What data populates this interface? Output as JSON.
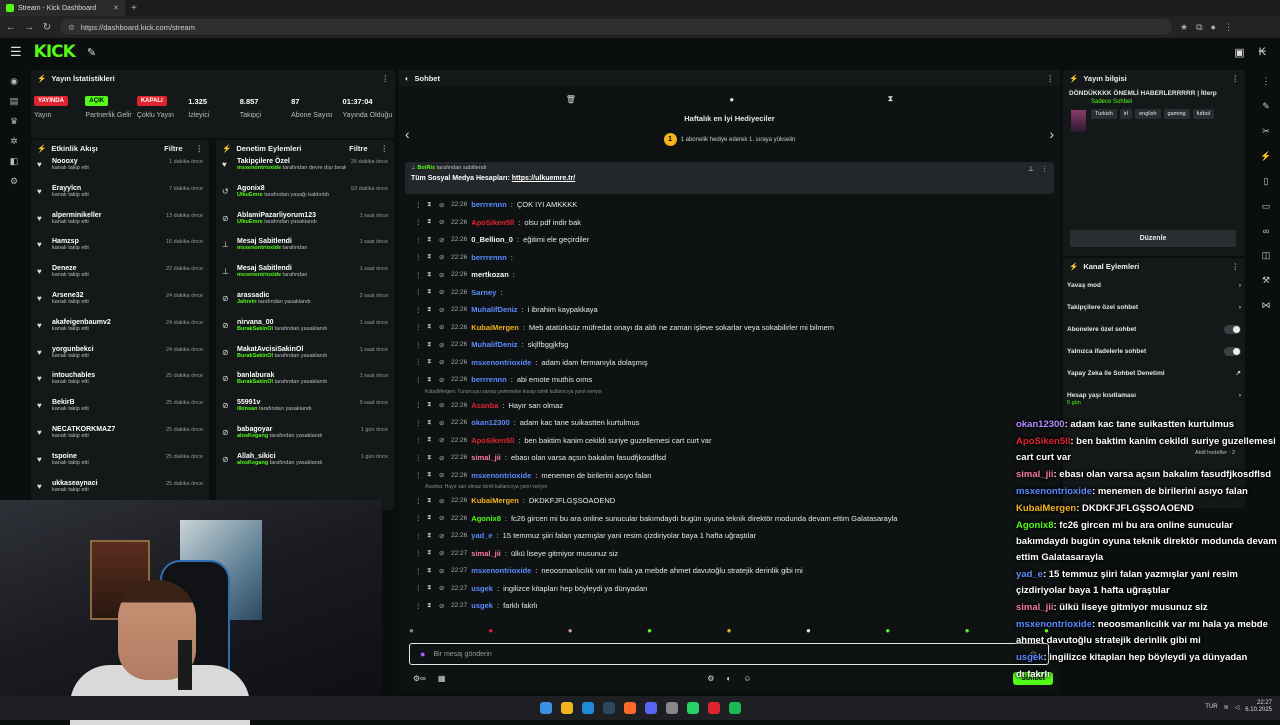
{
  "browser": {
    "tab_title": "Stream - Kick Dashboard",
    "url": "https://dashboard.kick.com/stream"
  },
  "stream_stats": {
    "header": "Yayın İstatistikleri",
    "items": [
      {
        "value": "YAYINDA",
        "label": "Yayın",
        "kind": "badge-red"
      },
      {
        "value": "AÇIK",
        "label": "Partnerlik Gelir",
        "kind": "badge-green"
      },
      {
        "value": "KAPALI",
        "label": "Çoklu Yayın",
        "kind": "badge-red"
      },
      {
        "value": "1.325",
        "label": "İzleyici",
        "kind": "number"
      },
      {
        "value": "8.857",
        "label": "Takipçi",
        "kind": "number"
      },
      {
        "value": "87",
        "label": "Abone Sayısı",
        "kind": "number"
      },
      {
        "value": "01:37:04",
        "label": "Yayında Olduğu",
        "kind": "number"
      }
    ]
  },
  "activity_feed": {
    "header": "Etkinlik Akışı",
    "filter": "Filtre",
    "items": [
      {
        "name": "Noooxy",
        "sub": "kanalı takip etti",
        "time": "1 dakika önce"
      },
      {
        "name": "Erayylcn",
        "sub": "kanalı takip etti",
        "time": "7 dakika önce"
      },
      {
        "name": "alperminikeller",
        "sub": "kanalı takip etti",
        "time": "13 dakika önce"
      },
      {
        "name": "Hamzsp",
        "sub": "kanalı takip etti",
        "time": "16 dakika önce"
      },
      {
        "name": "Deneze",
        "sub": "kanalı takip etti",
        "time": "22 dakika önce"
      },
      {
        "name": "Arsene32",
        "sub": "kanalı takip etti",
        "time": "24 dakika önce"
      },
      {
        "name": "akafeigenbaumv2",
        "sub": "kanalı takip etti",
        "time": "24 dakika önce"
      },
      {
        "name": "yorgunbekci",
        "sub": "kanalı takip etti",
        "time": "24 dakika önce"
      },
      {
        "name": "intouchables",
        "sub": "kanalı takip etti",
        "time": "25 dakika önce"
      },
      {
        "name": "BekirB",
        "sub": "kanalı takip etti",
        "time": "25 dakika önce"
      },
      {
        "name": "NECATKORKMAZ7",
        "sub": "kanalı takip etti",
        "time": "25 dakika önce"
      },
      {
        "name": "tspoine",
        "sub": "kanalı takip etti",
        "time": "25 dakika önce"
      },
      {
        "name": "ukkaseaynaci",
        "sub": "kanalı takip etti",
        "time": "25 dakika önce"
      }
    ]
  },
  "moderation": {
    "header": "Denetim Eylemleri",
    "filter": "Filtre",
    "items": [
      {
        "name": "Takipçilere Özel",
        "actor": "msxenontrioxide",
        "sub": "tarafından devre dışı bırakıldı",
        "time": "26 dakika önce",
        "icon": "♥"
      },
      {
        "name": "Agonix8",
        "actor": "UlkuEmre",
        "sub": "tarafından yasağı kaldırıldı",
        "time": "53 dakika önce",
        "icon": "↺"
      },
      {
        "name": "AblamiPazarliyorum123",
        "actor": "UlkuEmre",
        "sub": "tarafından yasaklandı",
        "time": "1 saat önce",
        "icon": "⊘"
      },
      {
        "name": "Mesaj Sabitlendi",
        "actor": "msxenontrioxide",
        "sub": "tarafından",
        "time": "1 saat önce",
        "icon": "⊥"
      },
      {
        "name": "Mesaj Sabitlendi",
        "actor": "msxenontrioxide",
        "sub": "tarafından",
        "time": "1 saat önce",
        "icon": "⊥"
      },
      {
        "name": "arassadic",
        "actor": "Jahrein",
        "sub": "tarafından yasaklandı",
        "time": "2 saat önce",
        "icon": "⊘"
      },
      {
        "name": "nirvana_00",
        "actor": "BurakSakinOl",
        "sub": "tarafından yasaklandı",
        "time": "1 saat önce",
        "icon": "⊘"
      },
      {
        "name": "MakatAvcisiSakinOl",
        "actor": "BurakSakinOl",
        "sub": "tarafından yasaklandı",
        "time": "1 saat önce",
        "icon": "⊘"
      },
      {
        "name": "banlaburak",
        "actor": "BurakSakinOl",
        "sub": "tarafından yasaklandı",
        "time": "1 saat önce",
        "icon": "⊘"
      },
      {
        "name": "55991v",
        "actor": "ilkinsan",
        "sub": "tarafından yasaklandı",
        "time": "9 saat önce",
        "icon": "⊘"
      },
      {
        "name": "babagoyar",
        "actor": "alosKegang",
        "sub": "tarafından yasaklandı",
        "time": "1 gün önce",
        "icon": "⊘"
      },
      {
        "name": "Allah_sikici",
        "actor": "alosKegang",
        "sub": "tarafından yasaklandı",
        "time": "1 gün önce",
        "icon": "⊘"
      }
    ]
  },
  "chat": {
    "header": "Sohbet",
    "gifters_title": "Haftalık en İyi Hediyeciler",
    "gifters_sub": "1 abonelik hediye ederek 1. sıraya yükselin",
    "gifters_rank": "1",
    "pinned_by": "BotRix",
    "pinned_suffix": "tarafından sabitlendi",
    "pinned_text": "Tüm Sosyal Medya Hesapları:",
    "pinned_link": "https://ulkuemre.tr/",
    "messages": [
      {
        "time": "22:26",
        "user": "berrrennn",
        "color": "#5a8cff",
        "text": "ÇOK IYI AMKKKK"
      },
      {
        "time": "22:26",
        "user": "ApoSiken5ll",
        "color": "#e0242f",
        "text": "olsu pdf indir bak"
      },
      {
        "time": "22:26",
        "user": "0_Bellion_0",
        "color": "#f3f3f3",
        "text": "eğitimi ele geçirdiler"
      },
      {
        "time": "22:26",
        "user": "berrrennn",
        "color": "#5a8cff",
        "text": ""
      },
      {
        "time": "22:26",
        "user": "mertkozan",
        "color": "#f3f3f3",
        "text": ""
      },
      {
        "time": "22:26",
        "user": "Sarney",
        "color": "#5a8cff",
        "text": ""
      },
      {
        "time": "22:26",
        "user": "MuhalifDeniz",
        "color": "#5a8cff",
        "text": "i ibrahim kaypakkaya"
      },
      {
        "time": "22:26",
        "user": "KubaiMergen",
        "color": "#f3b31c",
        "text": "Meb atatürksüz müfredat onayı da aldı ne zaman işleve sokarlar veya sokabilirler mi bilmem"
      },
      {
        "time": "22:26",
        "user": "MuhalifDeniz",
        "color": "#5a8cff",
        "text": "skjlfbggjkfsg"
      },
      {
        "time": "22:26",
        "user": "msxenontrioxide",
        "color": "#5a8cff",
        "text": "adam idam fermanıyla dolaşmış"
      },
      {
        "time": "22:26",
        "user": "berrrennn",
        "color": "#5a8cff",
        "text": "abi emote muthis oıms"
      },
      {
        "reply": "KubaiMergen: Turuncuyu sarıya çevirmekte kosay isimli kullanıcıya yanıt veriyor"
      },
      {
        "time": "22:26",
        "user": "Asanba",
        "color": "#e0242f",
        "text": "Hayır sarı olmaz"
      },
      {
        "time": "22:26",
        "user": "okan12300",
        "color": "#5a8cff",
        "text": "adam kac tane suikastten kurtulmus"
      },
      {
        "time": "22:26",
        "user": "ApoSiken5ll",
        "color": "#e0242f",
        "text": "ben baktim kanim cekildi suriye guzellemesi cart curt var"
      },
      {
        "time": "22:26",
        "user": "simal_jii",
        "color": "#f57a9b",
        "text": "ebası olan varsa açsın bakalım fasudfjkosdflsd"
      },
      {
        "time": "22:26",
        "user": "msxenontrioxide",
        "color": "#5a8cff",
        "text": "menemen de birilerini asıyo falan"
      },
      {
        "reply": "Asanba: Hayır sarı olmaz isimli kullanıcıya yanıt veriyor"
      },
      {
        "time": "22:26",
        "user": "KubaiMergen",
        "color": "#f3b31c",
        "text": "DKDKFJFLGŞSOAOEND"
      },
      {
        "time": "22:26",
        "user": "Agonix8",
        "color": "#53fc18",
        "text": "fc26 gircen mi bu ara online sunucular bakımdaydı bugün oyuna teknik direktör modunda devam ettim Galatasarayla"
      },
      {
        "time": "22:26",
        "user": "yad_e",
        "color": "#5a8cff",
        "text": "15 temmuz şiiri falan yazmışlar yani resim çizdiriyolar baya 1 hafta uğraştılar"
      },
      {
        "time": "22:27",
        "user": "simal_jii",
        "color": "#f57a9b",
        "text": "ülkü liseye gitmiyor musunuz siz"
      },
      {
        "time": "22:27",
        "user": "msxenontrioxide",
        "color": "#5a8cff",
        "text": "neoosmanlıcılık var mı hala ya mebde ahmet davutoğlu stratejik derinlik gibi mi"
      },
      {
        "time": "22:27",
        "user": "usgek",
        "color": "#5a8cff",
        "text": "ingilizce kitapları hep böyleydi ya dünyadan"
      },
      {
        "time": "22:27",
        "user": "usgek",
        "color": "#5a8cff",
        "text": "farklı fakrlı"
      }
    ],
    "input_placeholder": "Bir mesaj gönderin",
    "send_label": "Sohbet"
  },
  "stream_info": {
    "header": "Yayın bilgisi",
    "title": "DÖNDÜKKKK ÖNEMLİ HABERLERRRRR | İtlerp",
    "category": "Sadece Sohbet",
    "tags": [
      "Turkish",
      "irl",
      "english",
      "gaming",
      "futbol"
    ],
    "edit_label": "Düzenle"
  },
  "channel_actions": {
    "header": "Kanal Eylemleri",
    "items": [
      {
        "label": "Yavaş mod",
        "control": "arrow"
      },
      {
        "label": "Takipçilere özel sohbet",
        "control": "arrow"
      },
      {
        "label": "Abonelere özel sohbet",
        "control": "toggle"
      },
      {
        "label": "Yalnızca ifadelerle sohbet",
        "control": "toggle"
      },
      {
        "label": "Yapay Zeka ile Sohbet Denetimi",
        "control": "external"
      },
      {
        "label": "Hesap yaşı kısıtlaması",
        "control": "arrow"
      }
    ],
    "age_value": "5 gün",
    "aktif_hedefler": "Aktif hedefler · 2"
  },
  "overlay_chat": [
    {
      "user": "okan12300",
      "color": "#b58cff",
      "text": ": adam kac tane suikastten kurtulmus"
    },
    {
      "user": "ApoSiken5ll",
      "color": "#e0242f",
      "text": ": ben baktim kanim cekildi suriye guzellemesi cart curt var"
    },
    {
      "user": "simal_jii",
      "color": "#f57a9b",
      "text": ": ebası olan varsa açsın bakalım fasudfjkosdflsd"
    },
    {
      "user": "msxenontrioxide",
      "color": "#5a8cff",
      "text": ": menemen de birilerini asıyo falan"
    },
    {
      "user": "KubaiMergen",
      "color": "#f3b31c",
      "text": ": DKDKFJFLGŞSOAOEND"
    },
    {
      "user": "Agonix8",
      "color": "#53fc18",
      "text": ": fc26 gircen mi bu ara online sunucular bakımdaydı bugün oyuna teknik direktör modunda devam ettim Galatasarayla"
    },
    {
      "user": "yad_e",
      "color": "#5a8cff",
      "text": ": 15 temmuz şiiri falan yazmışlar yani resim çizdiriyolar baya 1 hafta uğraştılar"
    },
    {
      "user": "simal_jii",
      "color": "#f57a9b",
      "text": ": ülkü liseye gitmiyor musunuz siz"
    },
    {
      "user": "msxenontrioxide",
      "color": "#5a8cff",
      "text": ": neoosmanlıcılık var mı hala ya mebde ahmet davutoğlu stratejik derinlik gibi mi"
    },
    {
      "user": "usgek",
      "color": "#5a8cff",
      "text": ": ingilizce kitapları hep böyleydi ya dünyadan"
    },
    {
      "user": "",
      "color": "#ffffff",
      "text": "dı fakrlı"
    }
  ],
  "taskbar": {
    "time": "22:27",
    "date": "6.10.2025",
    "lang": "TUR"
  }
}
